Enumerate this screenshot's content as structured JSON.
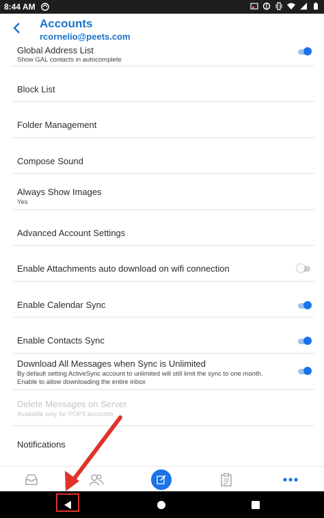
{
  "status_bar": {
    "time": "8:44 AM"
  },
  "header": {
    "title": "Accounts",
    "email": "rcornelio@peets.com"
  },
  "settings": [
    {
      "label": "Global Address List",
      "sub": "Show GAL contacts in autocomplete",
      "toggle": "on"
    },
    {
      "label": "Block List",
      "sub": "",
      "toggle": "none"
    },
    {
      "label": "Folder Management",
      "sub": "",
      "toggle": "none"
    },
    {
      "label": "Compose Sound",
      "sub": "",
      "toggle": "none"
    },
    {
      "label": "Always Show Images",
      "sub": "Yes",
      "toggle": "none"
    },
    {
      "label": "Advanced Account Settings",
      "sub": "",
      "toggle": "none"
    },
    {
      "label": "Enable Attachments auto download on wifi connection",
      "sub": "",
      "toggle": "off"
    },
    {
      "label": "Enable Calendar Sync",
      "sub": "",
      "toggle": "on"
    },
    {
      "label": "Enable Contacts Sync",
      "sub": "",
      "toggle": "on"
    },
    {
      "label": "Download All Messages when Sync is Unlimited",
      "sub": "By default setting ActiveSync account to unlimited will still limit the sync to one month.",
      "sub2": "Enable to allow downloading the entire inbox",
      "toggle": "on"
    },
    {
      "label": "Delete Messages on Server",
      "sub": "Available only for POP3 accounts",
      "toggle": "none",
      "disabled": true
    },
    {
      "label": "Notifications",
      "sub": "",
      "toggle": "none"
    }
  ],
  "bottom_nav": {
    "icons": [
      "inbox-icon",
      "contacts-icon",
      "compose-icon",
      "tasks-icon",
      "more-icon"
    ]
  },
  "colors": {
    "accent": "#1a73e8",
    "title_blue": "#1a73c9",
    "annotation_red": "#e0322b"
  }
}
